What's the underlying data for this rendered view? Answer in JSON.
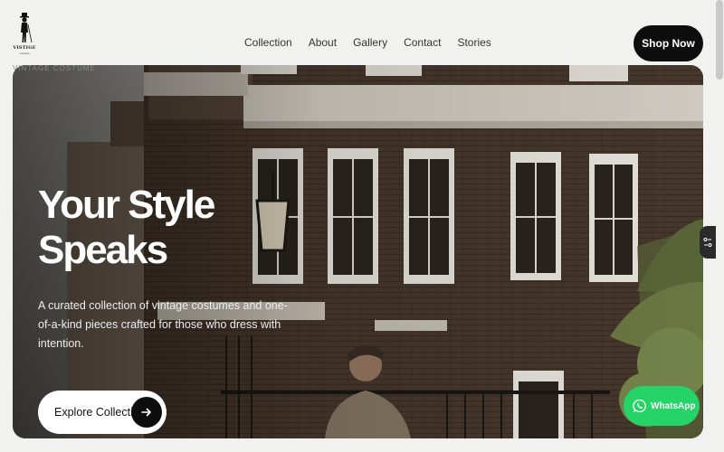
{
  "brand": {
    "name": "VISTIGE",
    "sub": "costume",
    "tagline": "VINTAGE COSTUME"
  },
  "nav": {
    "items": [
      "Collection",
      "About",
      "Gallery",
      "Contact",
      "Stories"
    ],
    "cta": "Shop Now"
  },
  "hero": {
    "title_line1": "Your Style",
    "title_line2": "Speaks",
    "description": "A curated collection of vintage costumes and one-of-a-kind pieces crafted for those who dress with intention.",
    "button_label": "Explore Collection"
  },
  "whatsapp": {
    "label": "WhatsApp"
  },
  "icons": {
    "logo": "dandy-figure-icon",
    "explore": "arrow-right-icon",
    "side_tab": "filter-icon",
    "whatsapp": "whatsapp-icon"
  },
  "colors": {
    "background": "#f1f1f0",
    "cta": "#0d0d0d",
    "whatsapp": "#25d366"
  }
}
